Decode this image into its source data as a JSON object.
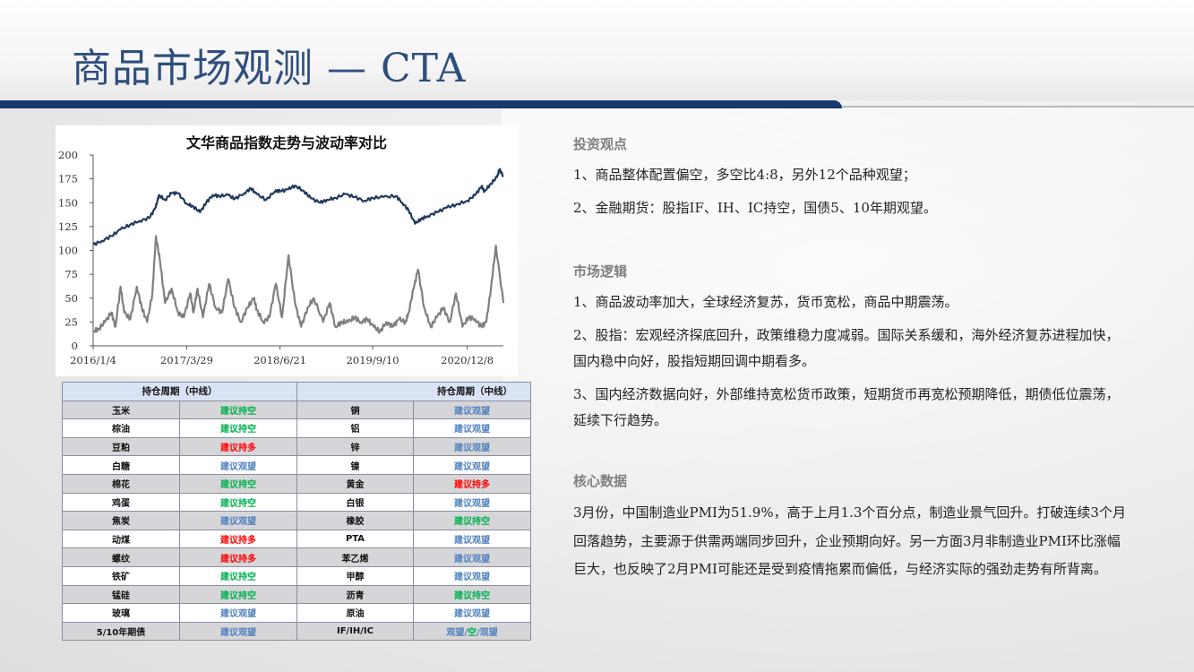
{
  "page": {
    "title": "商品市场观测 — CTA"
  },
  "colors": {
    "title": "#2f4e7e",
    "bar": "#153a6b",
    "index_line": "#1f3a5f",
    "vol_line": "#7f7f7f",
    "green": "#00b050",
    "red": "#ff0000",
    "blue": "#4f81bd"
  },
  "chart_data": {
    "type": "line",
    "title": "文华商品指数走势与波动率对比",
    "xlabel": "",
    "ylabel": "",
    "ylim": [
      0,
      200
    ],
    "yticks": [
      "0",
      "25",
      "50",
      "75",
      "100",
      "125",
      "150",
      "175",
      "200"
    ],
    "xticks": [
      "2016/1/4",
      "2017/3/29",
      "2018/6/21",
      "2019/9/10",
      "2020/12/8"
    ],
    "x_range": [
      "2016-01-04",
      "2021-05-31"
    ],
    "grid": false,
    "series": [
      {
        "name": "",
        "color": "#1f3a5f",
        "x": [
          "2016-01-04",
          "2016-02-15",
          "2016-04-01",
          "2016-05-15",
          "2016-06-30",
          "2016-08-15",
          "2016-09-30",
          "2016-10-31",
          "2016-11-15",
          "2016-12-15",
          "2017-01-15",
          "2017-02-15",
          "2017-03-29",
          "2017-04-30",
          "2017-06-01",
          "2017-07-01",
          "2017-08-01",
          "2017-09-01",
          "2017-10-15",
          "2017-11-15",
          "2017-12-31",
          "2018-02-01",
          "2018-03-01",
          "2018-04-15",
          "2018-06-01",
          "2018-06-21",
          "2018-07-31",
          "2018-09-01",
          "2018-10-15",
          "2018-11-15",
          "2018-12-31",
          "2019-02-01",
          "2019-03-15",
          "2019-05-01",
          "2019-06-15",
          "2019-08-01",
          "2019-09-10",
          "2019-10-31",
          "2019-12-31",
          "2020-01-31",
          "2020-03-01",
          "2020-04-01",
          "2020-04-30",
          "2020-06-01",
          "2020-07-15",
          "2020-09-01",
          "2020-10-15",
          "2020-12-08",
          "2021-01-15",
          "2021-02-15",
          "2021-03-01",
          "2021-04-01",
          "2021-05-01",
          "2021-05-12",
          "2021-05-31"
        ],
        "values": [
          106,
          110,
          115,
          122,
          127,
          131,
          134,
          145,
          158,
          153,
          160,
          160,
          149,
          146,
          140,
          150,
          158,
          157,
          158,
          154,
          160,
          165,
          159,
          153,
          163,
          162,
          164,
          168,
          162,
          155,
          150,
          153,
          155,
          159,
          156,
          152,
          155,
          156,
          157,
          150,
          142,
          128,
          133,
          136,
          140,
          145,
          148,
          152,
          158,
          167,
          162,
          170,
          177,
          185,
          178
        ]
      },
      {
        "name": "",
        "color": "#7f7f7f",
        "x": [
          "2016-01-04",
          "2016-02-01",
          "2016-03-01",
          "2016-04-01",
          "2016-04-20",
          "2016-05-15",
          "2016-06-01",
          "2016-07-01",
          "2016-08-01",
          "2016-08-25",
          "2016-09-20",
          "2016-10-15",
          "2016-11-01",
          "2016-11-20",
          "2016-12-15",
          "2017-01-15",
          "2017-02-15",
          "2017-03-15",
          "2017-04-15",
          "2017-05-01",
          "2017-05-20",
          "2017-06-15",
          "2017-07-15",
          "2017-08-15",
          "2017-09-15",
          "2017-10-15",
          "2017-11-15",
          "2017-12-15",
          "2018-01-15",
          "2018-02-15",
          "2018-03-01",
          "2018-04-01",
          "2018-05-01",
          "2018-06-01",
          "2018-07-01",
          "2018-08-01",
          "2018-09-01",
          "2018-10-01",
          "2018-11-01",
          "2018-12-01",
          "2019-01-15",
          "2019-02-15",
          "2019-03-15",
          "2019-04-15",
          "2019-05-15",
          "2019-06-15",
          "2019-07-15",
          "2019-08-15",
          "2019-09-15",
          "2019-10-15",
          "2019-11-15",
          "2019-12-15",
          "2020-01-15",
          "2020-02-15",
          "2020-03-01",
          "2020-03-25",
          "2020-04-15",
          "2020-05-15",
          "2020-06-15",
          "2020-07-15",
          "2020-08-15",
          "2020-09-15",
          "2020-10-15",
          "2020-11-15",
          "2020-12-15",
          "2021-01-15",
          "2021-02-15",
          "2021-03-10",
          "2021-04-01",
          "2021-04-25",
          "2021-05-31"
        ],
        "values": [
          15,
          18,
          25,
          35,
          20,
          62,
          35,
          28,
          62,
          40,
          25,
          55,
          115,
          90,
          45,
          60,
          35,
          30,
          55,
          35,
          60,
          30,
          65,
          40,
          35,
          70,
          40,
          25,
          40,
          50,
          38,
          25,
          30,
          65,
          30,
          95,
          45,
          20,
          40,
          50,
          25,
          45,
          20,
          25,
          25,
          30,
          25,
          28,
          20,
          15,
          25,
          20,
          28,
          25,
          35,
          60,
          80,
          40,
          20,
          30,
          40,
          25,
          55,
          20,
          30,
          28,
          20,
          25,
          60,
          105,
          45
        ]
      }
    ]
  },
  "table": {
    "header": [
      "",
      "持仓周期（中线）",
      "",
      "持仓周期（中线）"
    ],
    "rows": [
      {
        "c1": "玉米",
        "c2": "建议持空",
        "s2": "green",
        "c3": "铜",
        "c4": "建议观望",
        "s4": "blue"
      },
      {
        "c1": "棕油",
        "c2": "建议持空",
        "s2": "green",
        "c3": "铝",
        "c4": "建议观望",
        "s4": "blue"
      },
      {
        "c1": "豆粕",
        "c2": "建议持多",
        "s2": "red",
        "c3": "锌",
        "c4": "建议观望",
        "s4": "blue"
      },
      {
        "c1": "白糖",
        "c2": "建议观望",
        "s2": "blue",
        "c3": "镍",
        "c4": "建议观望",
        "s4": "blue"
      },
      {
        "c1": "棉花",
        "c2": "建议持空",
        "s2": "green",
        "c3": "黄金",
        "c4": "建议持多",
        "s4": "red"
      },
      {
        "c1": "鸡蛋",
        "c2": "建议持空",
        "s2": "green",
        "c3": "白银",
        "c4": "建议观望",
        "s4": "blue"
      },
      {
        "c1": "焦炭",
        "c2": "建议观望",
        "s2": "blue",
        "c3": "橡胶",
        "c4": "建议持空",
        "s4": "green"
      },
      {
        "c1": "动煤",
        "c2": "建议持多",
        "s2": "red",
        "c3": "PTA",
        "c4": "建议观望",
        "s4": "blue"
      },
      {
        "c1": "螺纹",
        "c2": "建议持多",
        "s2": "red",
        "c3": "苯乙烯",
        "c4": "建议观望",
        "s4": "blue"
      },
      {
        "c1": "铁矿",
        "c2": "建议持空",
        "s2": "green",
        "c3": "甲醇",
        "c4": "建议观望",
        "s4": "blue"
      },
      {
        "c1": "锰硅",
        "c2": "建议持空",
        "s2": "green",
        "c3": "沥青",
        "c4": "建议持空",
        "s4": "green"
      },
      {
        "c1": "玻璃",
        "c2": "建议观望",
        "s2": "blue",
        "c3": "原油",
        "c4": "建议观望",
        "s4": "blue"
      }
    ],
    "last_row": {
      "c1": "5/10年期债",
      "c2": "建议观望",
      "c3": "IF/IH/IC",
      "c4a": "观望",
      "c4b": "/",
      "c4c": "空",
      "c4d": "/",
      "c4e": "观望"
    }
  },
  "sections": {
    "invest": {
      "heading": "投资观点",
      "p1": "1、商品整体配置偏空，多空比4:8，另外12个品种观望；",
      "p2": "2、金融期货：股指IF、IH、IC持空，国债5、10年期观望。"
    },
    "logic": {
      "heading": "市场逻辑",
      "p1": "1、商品波动率加大，全球经济复苏，货币宽松，商品中期震荡。",
      "p2": "2、股指：宏观经济探底回升，政策维稳力度减弱。国际关系缓和，海外经济复苏进程加快，国内稳中向好，股指短期回调中期看多。",
      "p3": "3、国内经济数据向好，外部维持宽松货币政策，短期货币再宽松预期降低，期债低位震荡，延续下行趋势。"
    },
    "core": {
      "heading": "核心数据",
      "p1": "3月份，中国制造业PMI为51.9%，高于上月1.3个百分点，制造业景气回升。打破连续3个月回落趋势，主要源于供需两端同步回升，企业预期向好。另一方面3月非制造业PMI环比涨幅巨大，也反映了2月PMI可能还是受到疫情拖累而偏低，与经济实际的强劲走势有所背离。"
    }
  }
}
